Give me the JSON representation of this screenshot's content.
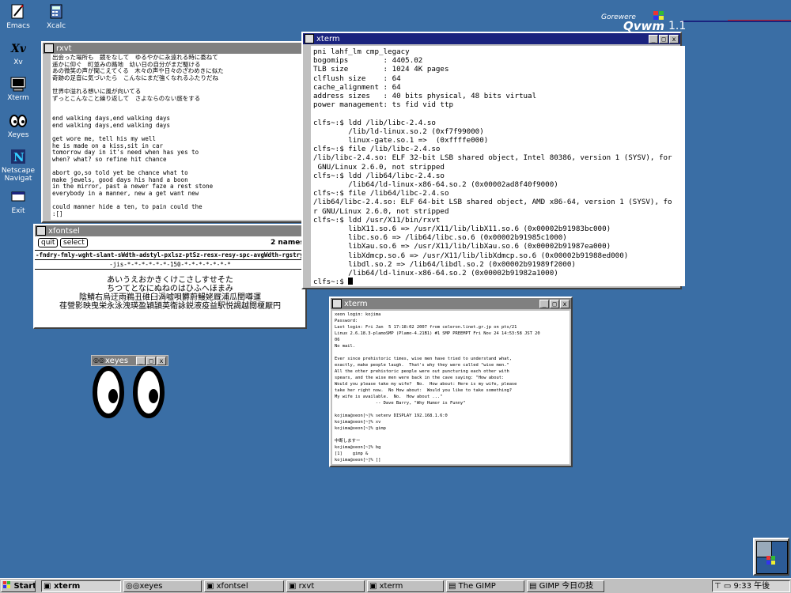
{
  "desktop_icons": [
    {
      "label": "Emacs",
      "icon": "emacs-icon"
    },
    {
      "label": "Xcalc",
      "icon": "calculator-icon"
    },
    {
      "label": "Xv",
      "icon": "xv-icon"
    },
    {
      "label": "Xterm",
      "icon": "terminal-icon"
    },
    {
      "label": "Xeyes",
      "icon": "eyes-icon"
    },
    {
      "label": "Netscape Navigat",
      "icon": "netscape-icon"
    },
    {
      "label": "Exit",
      "icon": "exit-icon"
    }
  ],
  "logo": {
    "small": "Gorewere",
    "big": "Qvwm",
    "version": "1.1"
  },
  "rxvt": {
    "title": "rxvt",
    "lines": [
      "出会った場所も　鏡をなして　ゆるやかに永遠れる時に委ねて",
      "遥かに仰ぐ　町並みの路地　幼い日の自分がまだ駆ける",
      "あの微笑の声が聞こえてくる　木々の声や日々のざわめきに似た",
      "奇跡の足音に気づいたら　こんなにまだ強くなれるふたりだね",
      "",
      "世界中溢れる想いに風が向いてる",
      "ずっとこんなこと繰り返して　さよならのない旅をする",
      "",
      "",
      "end walking days,end walking days",
      "end walking days,end walking days",
      "",
      "get wore me, tell his my well",
      "he is made on a kiss,sit in car",
      "tomorrow day in it's need when has yes to",
      "when? what? so refine hit chance",
      "",
      "abort go,so told yet be chance what to",
      "make jewels, good days his hand a boon",
      "in the mirror, past a newer faze a rest stone",
      "everybody in a manner, new a get want new",
      "",
      "could manner hide a ten, to pain could the",
      ":[]"
    ]
  },
  "xfontsel": {
    "title": "xfontsel",
    "quit": "quit",
    "select": "select",
    "names": "2 names m",
    "pattern": "-fndry-fmly-wght-slant-sWdth-adstyl-pxlsz-ptSz-resx-resy-spc-avgWdth-rgstry-e",
    "font": "-jis-*-*-*-*-*-*-150-*-*-*-*-*-*-*",
    "sample": [
      "あいうえおかきくけこさしすせそた",
      "ちつてとなにぬねのはひふへほまみ",
      "陰鯖右烏迂雨鵜丑碓臼渦嘘唄欝蔚鰻姥厩浦瓜閏噂運",
      "荏營影映曳栄永泳洩瑛盈穎頴英衛詠鋭液疫益駅悦謁越閲榎厭円"
    ]
  },
  "xeyes": {
    "title": "xeyes"
  },
  "xterm_top": {
    "title": "xterm",
    "lines": [
      "pni lahf_lm cmp_legacy",
      "bogomips        : 4405.02",
      "TLB size        : 1024 4K pages",
      "clflush size    : 64",
      "cache_alignment : 64",
      "address sizes   : 40 bits physical, 48 bits virtual",
      "power management: ts fid vid ttp",
      "",
      "clfs~:$ ldd /lib/libc-2.4.so",
      "        /lib/ld-linux.so.2 (0xf7f99000)",
      "        linux-gate.so.1 =>  (0xffffe000)",
      "clfs~:$ file /lib/libc-2.4.so",
      "/lib/libc-2.4.so: ELF 32-bit LSB shared object, Intel 80386, version 1 (SYSV), for",
      " GNU/Linux 2.6.0, not stripped",
      "clfs~:$ ldd /lib64/libc-2.4.so",
      "        /lib64/ld-linux-x86-64.so.2 (0x00002ad8f40f9000)",
      "clfs~:$ file /lib64/libc-2.4.so",
      "/lib64/libc-2.4.so: ELF 64-bit LSB shared object, AMD x86-64, version 1 (SYSV), fo",
      "r GNU/Linux 2.6.0, not stripped",
      "clfs~:$ ldd /usr/X11/bin/rxvt",
      "        libX11.so.6 => /usr/X11/lib/libX11.so.6 (0x00002b91983bc000)",
      "        libc.so.6 => /lib64/libc.so.6 (0x00002b91985c1000)",
      "        libXau.so.6 => /usr/X11/lib/libXau.so.6 (0x00002b91987ea000)",
      "        libXdmcp.so.6 => /usr/X11/lib/libXdmcp.so.6 (0x00002b91988ed000)",
      "        libdl.so.2 => /lib64/libdl.so.2 (0x00002b91989f2000)",
      "        /lib64/ld-linux-x86-64.so.2 (0x00002b91982a1000)",
      "clfs~:$ "
    ]
  },
  "xterm_bottom": {
    "title": "xterm",
    "lines": [
      "xeon login: kojima",
      "Password:",
      "Last login: Fri Jan  5 17:18:02 2007 from celeron.linet.gr.jp on pts/21",
      "Linux 2.6.18.3-plamoSMP (Plamo-4.21B1) #1 SMP PREEMPT Fri Nov 24 14:53:58 JST 20",
      "06",
      "No mail.",
      "",
      "Ever since prehistoric times, wise men have tried to understand what,",
      "exactly, make people laugh.  That's why they were called \"wise men.\"",
      "All the other prehistoric people were out puncturing each other with",
      "spears, and the wise men were back in the cave saying: \"How about:",
      "Would you please take my wife?  No.  How about: Here is my wife, please",
      "take her right now.  No How about:  Would you like to take something?",
      "My wife is available.  No.  How about ...\"",
      "                -- Dave Barry, \"Why Humor is Funny\"",
      "",
      "kojima@xeon[~]% setenv DISPLAY 192.168.1.6:0",
      "kojima@xeon[~]% xv",
      "kojima@xeon[~]% gimp",
      "",
      "中断しますー",
      "kojima@xeon[~]% bg",
      "[1]    gimp &",
      "kojima@xeon[~]% []"
    ]
  },
  "taskbar": {
    "start": "Start",
    "items": [
      "xterm",
      "xeyes",
      "xfontsel",
      "rxvt",
      "xterm",
      "The GIMP",
      "GIMP 今日の技"
    ],
    "clock": "9:33 午後"
  }
}
